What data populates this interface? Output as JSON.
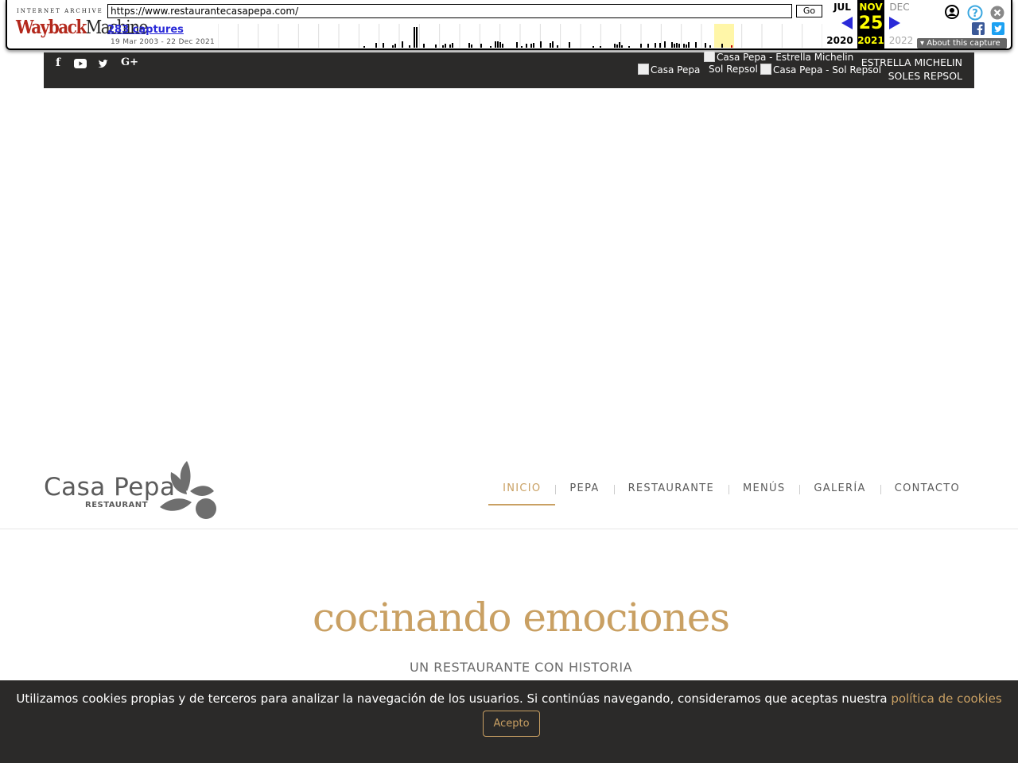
{
  "wayback": {
    "logo_top": "INTERNET ARCHIVE",
    "logo_word_1": "Wayback",
    "logo_word_2": "Machine",
    "url": "https://www.restaurantecasapepa.com/",
    "go_label": "Go",
    "captures": "283 captures",
    "date_range": "19 Mar 2003 - 22 Dec 2021",
    "prev_month": "JUL",
    "cur_month": "NOV",
    "next_month": "DEC",
    "cur_day": "25",
    "prev_year": "2020",
    "cur_year": "2021",
    "next_year": "2022",
    "about_label": "About this capture",
    "icons": [
      "user-icon",
      "help-icon",
      "close-icon",
      "facebook-icon",
      "twitter-icon"
    ]
  },
  "topbar": {
    "social": [
      "f",
      "▶",
      "t",
      "G+"
    ],
    "img_1_alt": "Casa Pepa",
    "img_2_alt": "Casa Pepa - Estrella Michelin",
    "img_2b_alt": "Sol Repsol",
    "img_3_alt": "Casa Pepa - Sol Repsol",
    "michelin_line_1": "ESTRELLA MICHELIN",
    "michelin_line_2": "SOLES REPSOL"
  },
  "brand": {
    "name": "Casa Pepa",
    "sub": "RESTAURANT"
  },
  "nav": {
    "items": [
      "INICIO",
      "PEPA",
      "RESTAURANTE",
      "MENÚS",
      "GALERÍA",
      "CONTACTO"
    ],
    "active_index": 0
  },
  "hero": {
    "headline": "cocinando emociones",
    "subline": "UN RESTAURANTE CON HISTORIA"
  },
  "cookie": {
    "text": "Utilizamos cookies propias y de terceros para analizar la navegación de los usuarios. Si continúas navegando, consideramos que aceptas nuestra ",
    "link": "política de cookies",
    "button": "Acepto"
  },
  "colors": {
    "accent": "#c9a063",
    "dark_bar": "#2b2a29",
    "text_grey": "#5b5b5b"
  }
}
